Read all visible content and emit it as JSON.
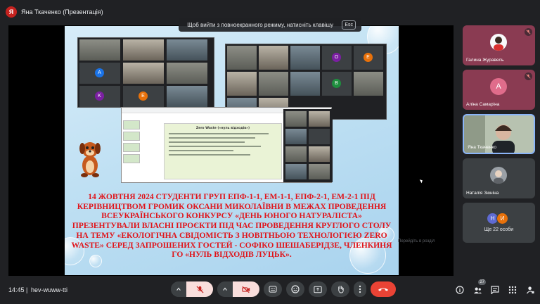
{
  "header": {
    "presenter_initial": "Я",
    "presenter_name": "Яна Ткаченко (Презентація)"
  },
  "fullscreen_toast": {
    "text": "Щоб вийти з повноекранного режиму, натисніть клавішу",
    "key": "Esc"
  },
  "slide": {
    "doc_title": "Zero Waste («нуль відходів»)",
    "body_text": "14 ЖОВТНЯ  2024 СТУДЕНТИ ГРУП ЕПФ-1-1, ЕМ-1-1, ЕПФ-2-1, ЕМ-2-1 ПІД КЕРІВНИЦТВОМ ГРОМИК ОКСАНИ МИКОЛАЇВНИ В МЕЖАХ ПРОВЕДЕННЯ ВСЕУКРАЇНСЬКОГО КОНКУРСУ «ДЕНЬ ЮНОГО НАТУРАЛІСТА» ПРЕЗЕНТУВАЛИ ВЛАСНІ ПРОЄКТИ  ПІД ЧАС ПРОВЕДЕННЯ КРУГЛОГО СТОЛУ НА ТЕМУ «ЕКОЛОГІЧНА СВІДОМІСТЬ З НОВІТНЬОЮ ТЕХНОЛОГІЄЮ ZERO WASTE» СЕРЕД ЗАПРОШЕНИХ ГОСТЕЙ - СОФІКО ШЕШАБЕРІДЗЕ, ЧЛЕНКИНЯ ГО «НУЛЬ ВІДХОДІВ ЛУЦЬК»."
  },
  "side_hint": "Перейдіть в розділ",
  "participants": [
    {
      "name": "Галина Журавель",
      "initial": "",
      "muted": true,
      "style": "pink",
      "avatar_color": "#f8f9fa"
    },
    {
      "name": "Аліна Самаріна",
      "initial": "А",
      "muted": true,
      "style": "pink",
      "avatar_color": "#e06c8b"
    },
    {
      "name": "Яна Ткаченко",
      "initial": "",
      "muted": false,
      "style": "cam",
      "avatar_color": ""
    },
    {
      "name": "Наталія Зюніна",
      "initial": "",
      "muted": false,
      "style": "dark",
      "avatar_color": "#9aa0a6"
    }
  ],
  "more_people": {
    "label": "Ще 22 особи",
    "avatars": [
      {
        "initial": "Н",
        "color": "#5e6ad2"
      },
      {
        "initial": "И",
        "color": "#e8710a"
      }
    ]
  },
  "footer": {
    "time": "14:45",
    "separator": "|",
    "meeting_code": "hev-wuww-tti",
    "participant_count": "27"
  },
  "colors": {
    "slide_text": "#e0151b",
    "hangup": "#ea4335",
    "active_ring": "#8ab4f8"
  }
}
